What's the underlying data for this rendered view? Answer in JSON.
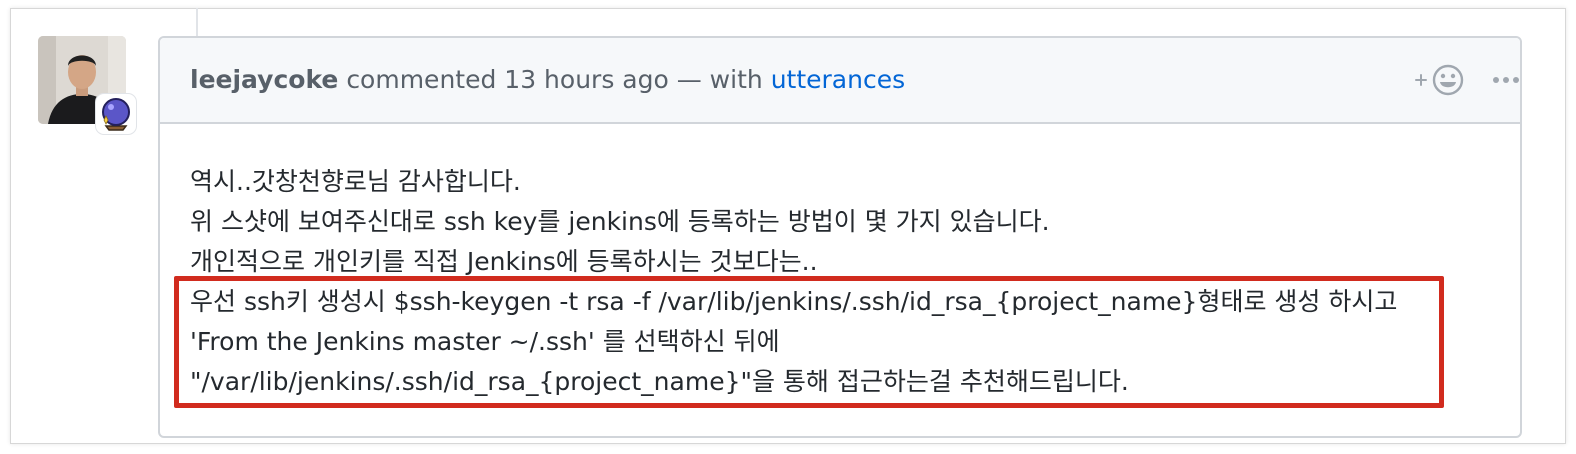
{
  "comment": {
    "author": "leejaycoke",
    "action": "commented",
    "time": "13 hours ago",
    "via_prefix": "— with",
    "via_app": "utterances",
    "body_lines": [
      "역시..갓창천향로님 감사합니다.",
      "위 스샷에 보여주신대로 ssh key를 jenkins에 등록하는 방법이 몇 가지 있습니다.",
      "개인적으로 개인키를 직접 Jenkins에 등록하시는 것보다는..",
      "우선 ssh키 생성시 $ssh-keygen -t rsa -f /var/lib/jenkins/.ssh/id_rsa_{project_name}형태로 생성 하시고",
      "'From the Jenkins master ~/.ssh' 를 선택하신 뒤에",
      "\"/var/lib/jenkins/.ssh/id_rsa_{project_name}\"을 통해 접근하는걸 추천해드립니다."
    ]
  },
  "icons": {
    "avatar": "user-avatar",
    "badge": "crystal-ball-icon",
    "reaction": "add-reaction-icon",
    "more": "more-options-icon"
  },
  "colors": {
    "link": "#0366d6",
    "highlight": "#d12b1e",
    "header_bg": "#f6f8fa",
    "border": "#d1d5da"
  }
}
